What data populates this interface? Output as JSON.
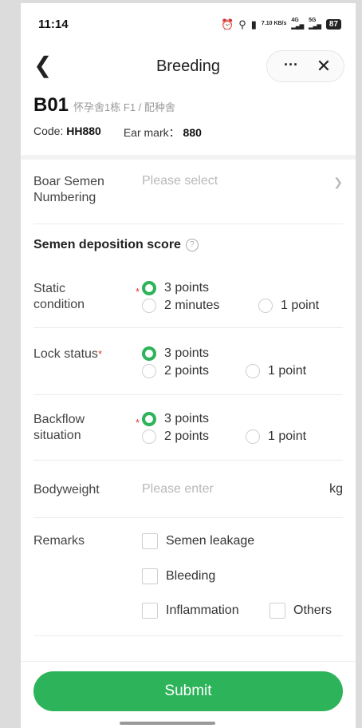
{
  "status_bar": {
    "time": "11:14",
    "speed": "7.10 KB/s",
    "net1": "4G",
    "net2": "5G",
    "battery": "87"
  },
  "nav": {
    "title": "Breeding",
    "back_icon": "chevron-left-icon",
    "more_icon": "more-dots-icon",
    "close_icon": "close-icon"
  },
  "header": {
    "pig_id": "B01",
    "location": "怀孕舍1栋 F1 / 配种舍",
    "code_label": "Code:",
    "code_value": "HH880",
    "ear_label": "Ear mark：",
    "ear_value": "880"
  },
  "form": {
    "boar": {
      "label": "Boar Semen Numbering",
      "placeholder": "Please select"
    },
    "section_title": "Semen deposition score",
    "static_condition": {
      "label": "Static condition",
      "options": [
        "3 points",
        "2 minutes",
        "1 point"
      ],
      "selected": "3 points"
    },
    "lock_status": {
      "label": "Lock status",
      "required_mark": "*",
      "options": [
        "3 points",
        "2 points",
        "1 point"
      ],
      "selected": "3 points"
    },
    "backflow": {
      "label": "Backflow situation",
      "options": [
        "3 points",
        "2 points",
        "1 point"
      ],
      "selected": "3 points"
    },
    "bodyweight": {
      "label": "Bodyweight",
      "placeholder": "Please enter",
      "unit": "kg"
    },
    "remarks": {
      "label": "Remarks",
      "options": [
        "Semen leakage",
        "Bleeding",
        "Inflammation",
        "Others"
      ]
    }
  },
  "submit_label": "Submit",
  "colors": {
    "accent": "#2db35a",
    "required": "#e53935"
  }
}
